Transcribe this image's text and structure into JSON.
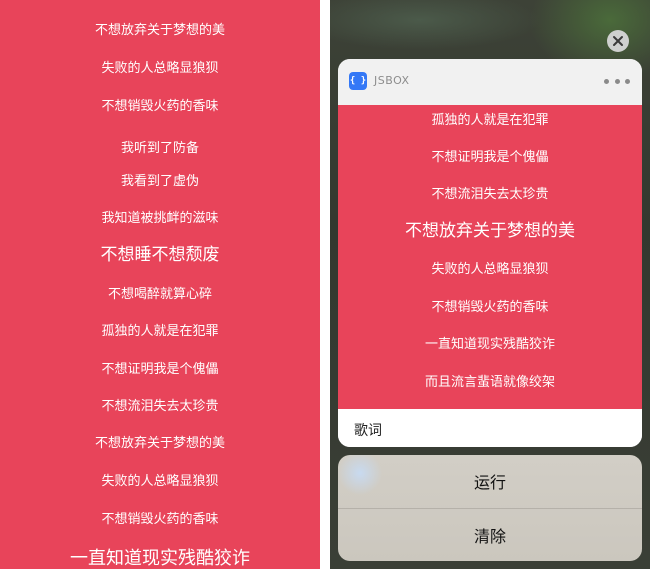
{
  "left_panel": {
    "lyrics": [
      "不想放弃关于梦想的美",
      "失败的人总略显狼狈",
      "不想销毁火药的香味",
      "我听到了防备",
      "我看到了虚伪",
      "我知道被挑衅的滋味",
      "不想睡不想颓废",
      "不想喝醉就算心碎",
      "孤独的人就是在犯罪",
      "不想证明我是个傀儡",
      "不想流泪失去太珍贵",
      "不想放弃关于梦想的美",
      "失败的人总略显狼狈",
      "不想销毁火药的香味",
      "一直知道现实残酷狡诈"
    ]
  },
  "widget": {
    "app_name": "JSBOX",
    "app_icon": "{ }",
    "lyrics": [
      "孤独的人就是在犯罪",
      "不想证明我是个傀儡",
      "不想流泪失去太珍贵",
      "不想放弃关于梦想的美",
      "失败的人总略显狼狈",
      "不想销毁火药的香味",
      "一直知道现实残酷狡诈",
      "而且流言蜚语就像绞架"
    ],
    "footer_label": "歌词"
  },
  "actions": {
    "run_label": "运行",
    "clear_label": "清除"
  },
  "colors": {
    "lyrics_bg": "#e8445a",
    "accent": "#3478f6"
  }
}
